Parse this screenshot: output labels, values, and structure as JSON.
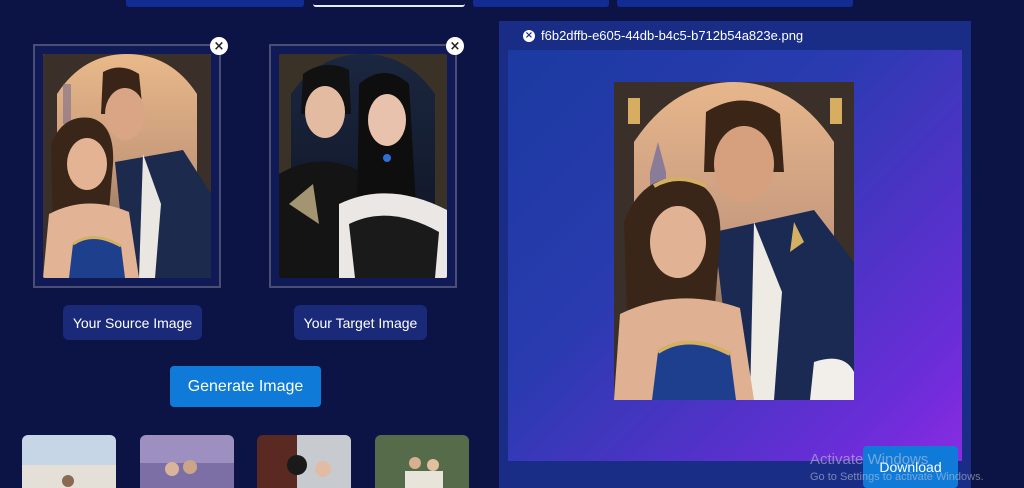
{
  "tabs": [
    {
      "name": "tab-1"
    },
    {
      "name": "tab-2-active"
    },
    {
      "name": "tab-3"
    },
    {
      "name": "tab-4"
    }
  ],
  "source": {
    "label": "Your Source Image",
    "close_icon": "close-icon",
    "close_glyph": "×"
  },
  "target": {
    "label": "Your Target Image",
    "close_icon": "close-icon",
    "close_glyph": "×"
  },
  "generate_label": "Generate Image",
  "result": {
    "filename": "f6b2dffb-e605-44db-b4c5-b712b54a823e.png",
    "close_glyph": "×",
    "download_label": "Download"
  },
  "watermark": {
    "line1": "Activate Windows",
    "line2": "Go to Settings to activate Windows."
  },
  "colors": {
    "background": "#0c1446",
    "panel": "#192d86",
    "accent": "#0f7ad8",
    "label_button": "#1a2a78"
  }
}
